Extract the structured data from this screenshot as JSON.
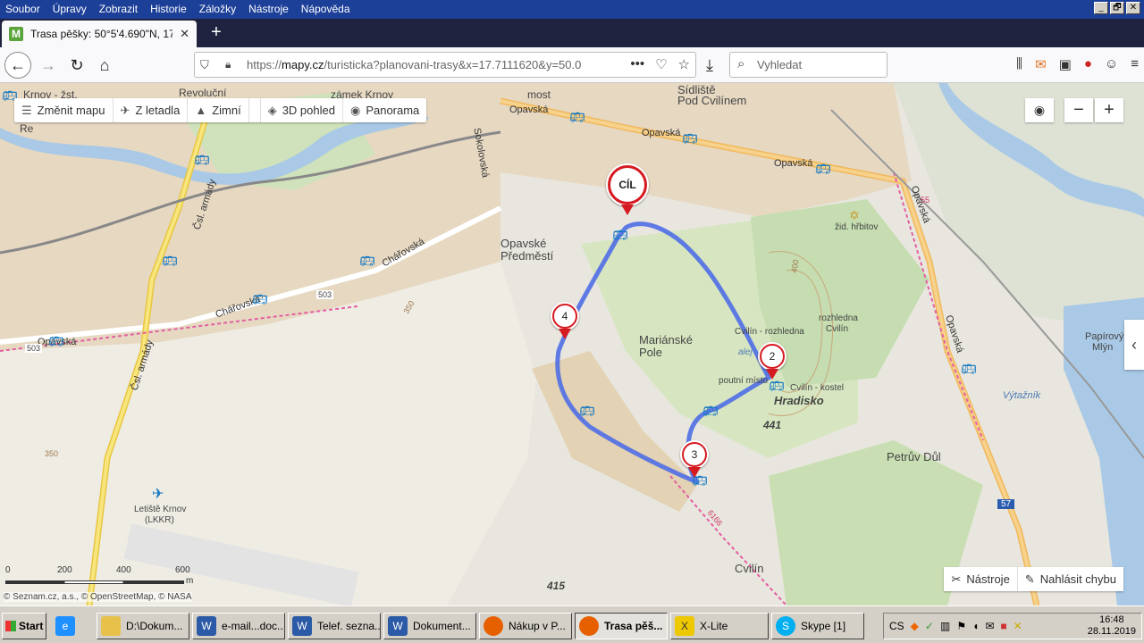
{
  "window": {
    "menu": [
      "Soubor",
      "Úpravy",
      "Zobrazit",
      "Historie",
      "Záložky",
      "Nástroje",
      "Nápověda"
    ],
    "buttons": [
      "_",
      "🗗",
      "✕"
    ]
  },
  "tab": {
    "favicon": "M",
    "title": "Trasa pěšky: 50°5'4.690\"N, 17°4",
    "close": "✕",
    "new_tab": "+"
  },
  "nav": {
    "url_prefix": "https://",
    "url_domain": "mapy.cz",
    "url_path": "/turisticka?planovani-trasy&x=17.7111620&y=50.0",
    "search_placeholder": "Vyhledat"
  },
  "map": {
    "toolbar": {
      "change_map": "Změnit mapu",
      "from_plane": "Z letadla",
      "terrain": "Zimní",
      "view3d": "3D pohled",
      "panorama": "Panorama"
    },
    "zoom": {
      "minus": "−",
      "plus": "+"
    },
    "bottom": {
      "tools": "Nástroje",
      "report": "Nahlásit chybu"
    },
    "scale": {
      "ticks": [
        "0",
        "200",
        "400",
        "600"
      ],
      "unit": "m"
    },
    "copyright": "© Seznam.cz, a.s., © OpenStreetMap, © NASA",
    "markers": {
      "finish": "CÍL",
      "m2": "2",
      "m3": "3",
      "m4": "4"
    },
    "labels": {
      "krnov": "Krnov - žst.",
      "revolucni": "Revoluční",
      "zamek": "zámek Krnov",
      "sidliste": "Sídliště",
      "pod_cvilinem": "Pod Cvilínem",
      "opavska1": "Opavská",
      "opavska2": "Opavská",
      "opavska3": "Opavská",
      "opavska4": "Opavská",
      "opavska5": "Opavská",
      "opavska6": "Opavská",
      "opavska7": "Opavská",
      "sokolovska": "Sokolovská",
      "csl_armady1": "Čsl. armády",
      "csl_armady2": "Čsl. armády",
      "chaforvska1": "Chářovská",
      "chaforvska2": "Chářovská",
      "opavske": "Opavské",
      "predmesti": "Předměstí",
      "marianske": "Mariánské",
      "pole": "Pole",
      "zid_hrbitov": "žid. hřbitov",
      "rozhledna1": "rozhledna",
      "rozhledna2": "Cvilín",
      "cvilin_rozhledna": "Cvilín - rozhledna",
      "poutni": "poutní místo",
      "cvilin_kostel": "Cvilín - kostel",
      "hradisko": "Hradisko",
      "h441": "441",
      "petruv_dul": "Petrův Důl",
      "papirovy": "Papírový",
      "mlyn": "Mlýn",
      "vytaznik": "Výtažník",
      "letiste": "Letiště Krnov",
      "lkkr": "(LKKR)",
      "cvilin": "Cvilín",
      "h415": "415",
      "road503a": "503",
      "road503b": "503",
      "road57": "57",
      "h400": "400",
      "h350a": "350",
      "h350b": "350",
      "road55": "55",
      "road6166": "6166",
      "revoluc_left": "Re",
      "most": "most",
      "alej": "alej"
    }
  },
  "taskbar": {
    "start": "Start",
    "buttons": [
      {
        "label": "D:\\Dokum..."
      },
      {
        "label": "e-mail...doc..."
      },
      {
        "label": "Telef. sezna..."
      },
      {
        "label": "Dokument..."
      },
      {
        "label": "Nákup v P..."
      },
      {
        "label": "Trasa pěš..."
      },
      {
        "label": "X-Lite"
      },
      {
        "label": "Skype [1]"
      }
    ],
    "lang": "CS",
    "time": "16:48",
    "date": "28.11.2019"
  }
}
